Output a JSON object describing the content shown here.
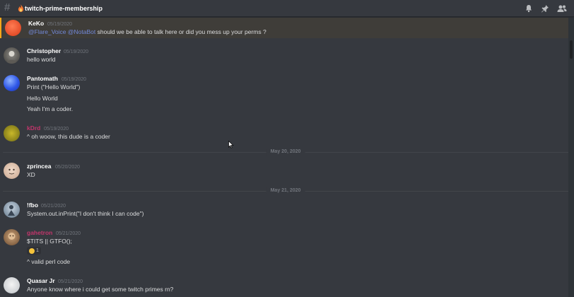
{
  "channel": {
    "name": "twitch-prime-membership",
    "icons": [
      "hash-icon",
      "flame-icon",
      "bell-icon",
      "pin-icon",
      "members-icon"
    ]
  },
  "messages": [
    {
      "author": "KeKo",
      "author_color": "#ffffff",
      "timestamp": "05/19/2020",
      "avatar": "orange-avatar",
      "mentions": [
        "@Flare_Voice",
        "@NotaBot"
      ],
      "text": "should we be able to talk here or did you mess up your perms ?",
      "highlight": true
    },
    {
      "author": "Christopher",
      "author_color": "#ffffff",
      "timestamp": "05/19/2020",
      "avatar": "photo-avatar",
      "lines": [
        "hello world"
      ]
    },
    {
      "author": "Pantomath",
      "author_color": "#ffffff",
      "timestamp": "05/19/2020",
      "avatar": "blue-avatar",
      "lines": [
        "Print (\"Hello World\")",
        "Hello World",
        "Yeah I'm a coder."
      ]
    },
    {
      "author": "kDrd",
      "author_color": "#c1356b",
      "timestamp": "05/19/2020",
      "avatar": "olive-avatar",
      "lines": [
        "^ oh woow, this dude is a coder"
      ]
    },
    {
      "author": "zprincea",
      "author_color": "#ffffff",
      "timestamp": "05/20/2020",
      "avatar": "cartoon-avatar",
      "lines": [
        "XD"
      ]
    },
    {
      "author": "!fbo",
      "author_color": "#ffffff",
      "timestamp": "05/21/2020",
      "avatar": "skater-avatar",
      "lines": [
        "System.out.inPrint(\"I don't think I can code\")"
      ]
    },
    {
      "author": "gahetron",
      "author_color": "#c1356b",
      "timestamp": "05/21/2020",
      "avatar": "face-avatar",
      "lines": [
        "$TITS || GTFO();",
        "^ valid perl code"
      ],
      "reaction": {
        "emoji": "grinning-face",
        "count": "1"
      }
    },
    {
      "author": "Quasar Jr",
      "author_color": "#ffffff",
      "timestamp": "05/21/2020",
      "avatar": "white-avatar",
      "lines": [
        "Anyone know where i could get some twitch primes rn?"
      ]
    }
  ],
  "dividers": [
    "May 20, 2020",
    "May 21, 2020"
  ]
}
